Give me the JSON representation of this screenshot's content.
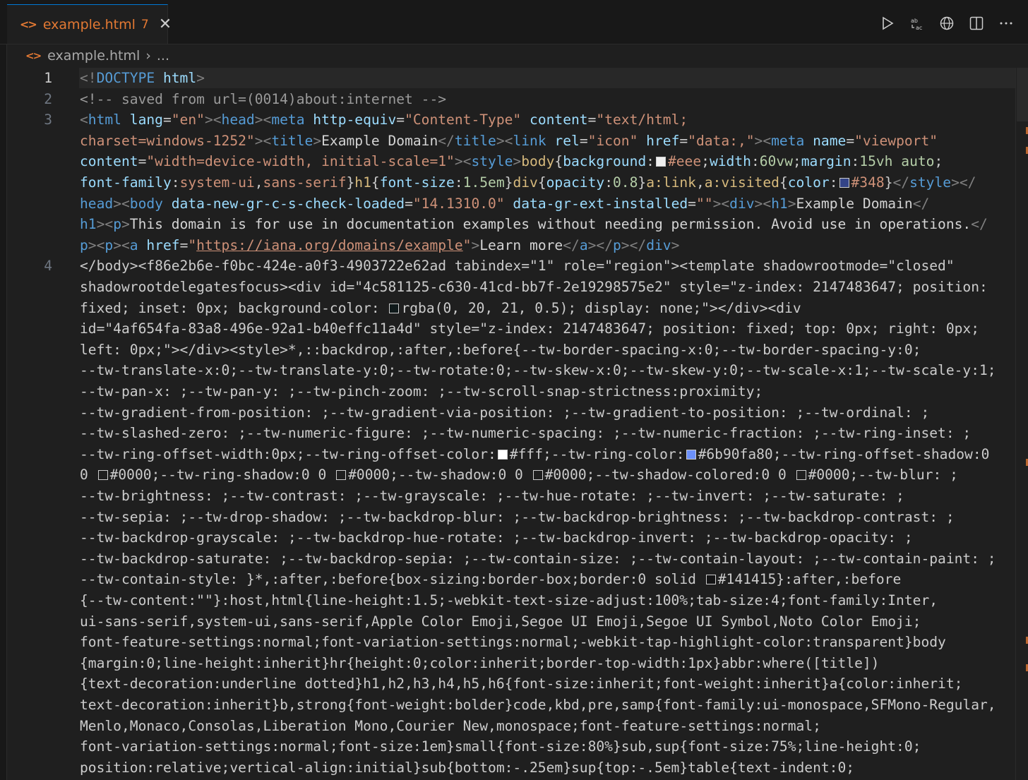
{
  "tab": {
    "filename": "example.html",
    "problems": "7",
    "close": "✕"
  },
  "breadcrumb": {
    "file": "example.html",
    "separator": "›",
    "more": "..."
  },
  "actions": [
    "run-icon",
    "replace-icon",
    "preview-icon",
    "split-editor-icon",
    "more-icon"
  ],
  "colors": {
    "accent": "#0078d4",
    "html_icon": "#e37933",
    "background": "#1f1f1f"
  },
  "line_numbers": [
    "1",
    "2",
    "3",
    "4"
  ],
  "code": {
    "l1": [
      "<!",
      "DOCTYPE",
      " html",
      ">"
    ],
    "l2": "<!-- saved from url=(0014)about:internet -->",
    "l3a": [
      "<",
      "html",
      " lang",
      "=",
      "\"en\"",
      "><",
      "head",
      "><",
      "meta",
      " http-equiv",
      "=",
      "\"Content-Type\"",
      " content",
      "=",
      "\"text/html;"
    ],
    "l3b": [
      "charset=windows-1252\"",
      "><",
      "title",
      ">",
      "Example Domain",
      "</",
      "title",
      "><",
      "link",
      " rel",
      "=",
      "\"icon\"",
      " href",
      "=",
      "\"data:,\"",
      "><",
      "meta",
      " name",
      "=",
      "\"viewport\""
    ],
    "l3c": [
      "content",
      "=",
      "\"width=device-width, initial-scale=1\"",
      "><",
      "style",
      ">",
      "body",
      "{",
      "background",
      ":",
      "#eee",
      ";",
      "width",
      ":",
      "60vw",
      ";",
      "margin",
      ":",
      "15vh auto",
      ";"
    ],
    "l3d": [
      "font-family",
      ":",
      "system-ui",
      ",",
      "sans-serif",
      "}",
      "h1",
      "{",
      "font-size",
      ":",
      "1.5em",
      "}",
      "div",
      "{",
      "opacity",
      ":",
      "0.8",
      "}",
      "a:link",
      ",",
      "a:visited",
      "{",
      "color",
      ":",
      "#348",
      "}",
      "</",
      "style",
      "></"
    ],
    "l3e": [
      "head",
      "><",
      "body",
      " data-new-gr-c-s-check-loaded",
      "=",
      "\"14.1310.0\"",
      " data-gr-ext-installed",
      "=",
      "\"\"",
      "><",
      "div",
      "><",
      "h1",
      ">",
      "Example Domain",
      "</"
    ],
    "l3f": [
      "h1",
      "><",
      "p",
      ">",
      "This domain is for use in documentation examples without needing permission. Avoid use in operations.",
      "</"
    ],
    "l3g": [
      "p",
      "><",
      "p",
      "><",
      "a",
      " href",
      "=",
      "\"",
      "https://iana.org/domains/example",
      "\"",
      ">",
      "Learn more",
      "</",
      "a",
      "></",
      "p",
      "></",
      "div",
      ">"
    ],
    "l4": [
      "</body><f86e2b6e-f0bc-424e-a0f3-4903722e62ad tabindex=\"1\" role=\"region\"><template shadowrootmode=\"closed\"",
      "shadowrootdelegatesfocus><div id=\"4c581125-c630-41cd-bb7f-2e19298575e2\" style=\"z-index: 2147483647; position:",
      [
        "fixed; inset: 0px; background-color: ",
        "rgba(0, 20, 21, 0.5); display: none;\"></div><div"
      ],
      "id=\"4af654fa-83a8-496e-92a1-b40effc11a4d\" style=\"z-index: 2147483647; position: fixed; top: 0px; right: 0px;",
      "left: 0px;\"></div><style>*,::backdrop,:after,:before{--tw-border-spacing-x:0;--tw-border-spacing-y:0;",
      "--tw-translate-x:0;--tw-translate-y:0;--tw-rotate:0;--tw-skew-x:0;--tw-skew-y:0;--tw-scale-x:1;--tw-scale-y:1;",
      "--tw-pan-x: ;--tw-pan-y: ;--tw-pinch-zoom: ;--tw-scroll-snap-strictness:proximity;",
      "--tw-gradient-from-position: ;--tw-gradient-via-position: ;--tw-gradient-to-position: ;--tw-ordinal: ;",
      "--tw-slashed-zero: ;--tw-numeric-figure: ;--tw-numeric-spacing: ;--tw-numeric-fraction: ;--tw-ring-inset: ;",
      [
        "--tw-ring-offset-width:0px;--tw-ring-offset-color:",
        "#fff;--tw-ring-color:",
        "#6b90fa80;--tw-ring-offset-shadow:0"
      ],
      [
        "0 ",
        "#0000;--tw-ring-shadow:0 0 ",
        "#0000;--tw-shadow:0 0 ",
        "#0000;--tw-shadow-colored:0 0 ",
        "#0000;--tw-blur: ;"
      ],
      "--tw-brightness: ;--tw-contrast: ;--tw-grayscale: ;--tw-hue-rotate: ;--tw-invert: ;--tw-saturate: ;",
      "--tw-sepia: ;--tw-drop-shadow: ;--tw-backdrop-blur: ;--tw-backdrop-brightness: ;--tw-backdrop-contrast: ;",
      "--tw-backdrop-grayscale: ;--tw-backdrop-hue-rotate: ;--tw-backdrop-invert: ;--tw-backdrop-opacity: ;",
      "--tw-backdrop-saturate: ;--tw-backdrop-sepia: ;--tw-contain-size: ;--tw-contain-layout: ;--tw-contain-paint: ;",
      [
        "--tw-contain-style: }*,:after,:before{box-sizing:border-box;border:0 solid ",
        "#141415}:after,:before"
      ],
      "{--tw-content:\"\"}:host,html{line-height:1.5;-webkit-text-size-adjust:100%;tab-size:4;font-family:Inter,",
      "ui-sans-serif,system-ui,sans-serif,Apple Color Emoji,Segoe UI Emoji,Segoe UI Symbol,Noto Color Emoji;",
      "font-feature-settings:normal;font-variation-settings:normal;-webkit-tap-highlight-color:transparent}body",
      "{margin:0;line-height:inherit}hr{height:0;color:inherit;border-top-width:1px}abbr:where([title])",
      "{text-decoration:underline dotted}h1,h2,h3,h4,h5,h6{font-size:inherit;font-weight:inherit}a{color:inherit;",
      "text-decoration:inherit}b,strong{font-weight:bolder}code,kbd,pre,samp{font-family:ui-monospace,SFMono-Regular,",
      "Menlo,Monaco,Consolas,Liberation Mono,Courier New,monospace;font-feature-settings:normal;",
      "font-variation-settings:normal;font-size:1em}small{font-size:80%}sub,sup{font-size:75%;line-height:0;",
      "position:relative;vertical-align:initial}sub{bottom:-.25em}sup{top:-.5em}table{text-indent:0;"
    ]
  }
}
